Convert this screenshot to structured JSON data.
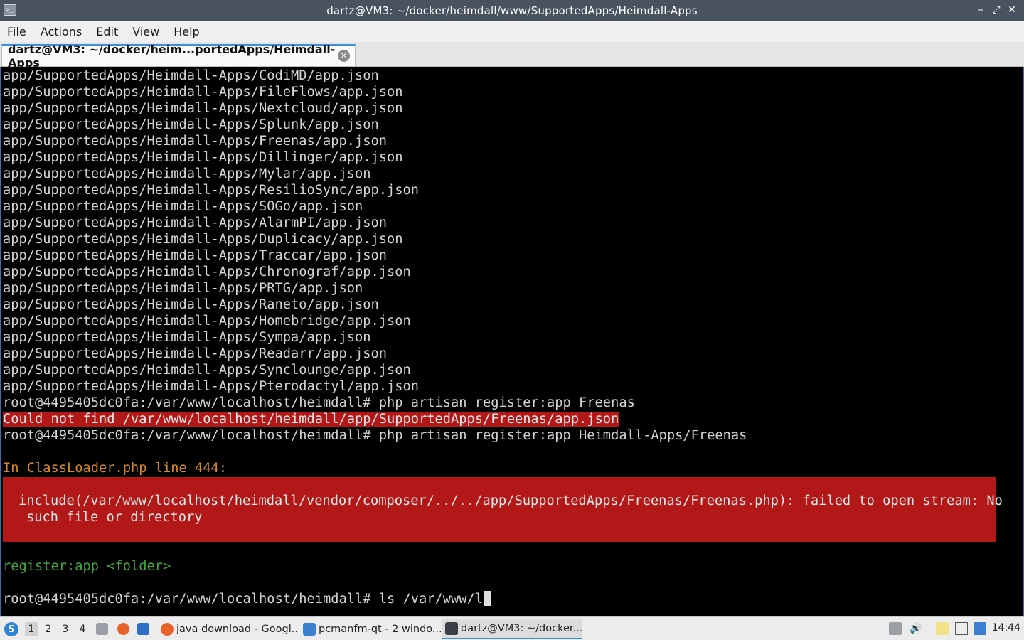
{
  "window": {
    "title": "dartz@VM3: ~/docker/heimdall/www/SupportedApps/Heimdall-Apps",
    "controls": [
      "–",
      "⤢",
      "✕"
    ]
  },
  "menu": [
    "File",
    "Actions",
    "Edit",
    "View",
    "Help"
  ],
  "tab": {
    "label": "dartz@VM3: ~/docker/heim...portedApps/Heimdall-Apps",
    "close_icon": "close-icon"
  },
  "terminal": {
    "lines": [
      "app/SupportedApps/Heimdall-Apps/CodiMD/app.json",
      "app/SupportedApps/Heimdall-Apps/FileFlows/app.json",
      "app/SupportedApps/Heimdall-Apps/Nextcloud/app.json",
      "app/SupportedApps/Heimdall-Apps/Splunk/app.json",
      "app/SupportedApps/Heimdall-Apps/Freenas/app.json",
      "app/SupportedApps/Heimdall-Apps/Dillinger/app.json",
      "app/SupportedApps/Heimdall-Apps/Mylar/app.json",
      "app/SupportedApps/Heimdall-Apps/ResilioSync/app.json",
      "app/SupportedApps/Heimdall-Apps/SOGo/app.json",
      "app/SupportedApps/Heimdall-Apps/AlarmPI/app.json",
      "app/SupportedApps/Heimdall-Apps/Duplicacy/app.json",
      "app/SupportedApps/Heimdall-Apps/Traccar/app.json",
      "app/SupportedApps/Heimdall-Apps/Chronograf/app.json",
      "app/SupportedApps/Heimdall-Apps/PRTG/app.json",
      "app/SupportedApps/Heimdall-Apps/Raneto/app.json",
      "app/SupportedApps/Heimdall-Apps/Homebridge/app.json",
      "app/SupportedApps/Heimdall-Apps/Sympa/app.json",
      "app/SupportedApps/Heimdall-Apps/Readarr/app.json",
      "app/SupportedApps/Heimdall-Apps/Synclounge/app.json",
      "app/SupportedApps/Heimdall-Apps/Pterodactyl/app.json",
      "root@4495405dc0fa:/var/www/localhost/heimdall# php artisan register:app Freenas"
    ],
    "not_found_error": "Could not find /var/www/localhost/heimdall/app/SupportedApps/Freenas/app.json",
    "second_command": "root@4495405dc0fa:/var/www/localhost/heimdall# php artisan register:app Heimdall-Apps/Freenas",
    "exception_location": "In ClassLoader.php line 444:",
    "exception_line_1": "include(/var/www/localhost/heimdall/vendor/composer/../../app/SupportedApps/Freenas/Freenas.php): failed to open stream: No",
    "exception_line_2": "such file or directory",
    "usage": "register:app <folder>",
    "current_prompt": "root@4495405dc0fa:/var/www/localhost/heimdall# ls /var/www/l"
  },
  "taskbar": {
    "desktops": [
      "1",
      "2",
      "3",
      "4"
    ],
    "tasks": [
      {
        "label": "java download - Googl...",
        "icon": "firefox-icon"
      },
      {
        "label": "pcmanfm-qt - 2 windo...",
        "icon": "folder-icon"
      },
      {
        "label": "dartz@VM3: ~/docker...",
        "icon": "terminal-icon"
      }
    ],
    "clock": "14:44"
  }
}
